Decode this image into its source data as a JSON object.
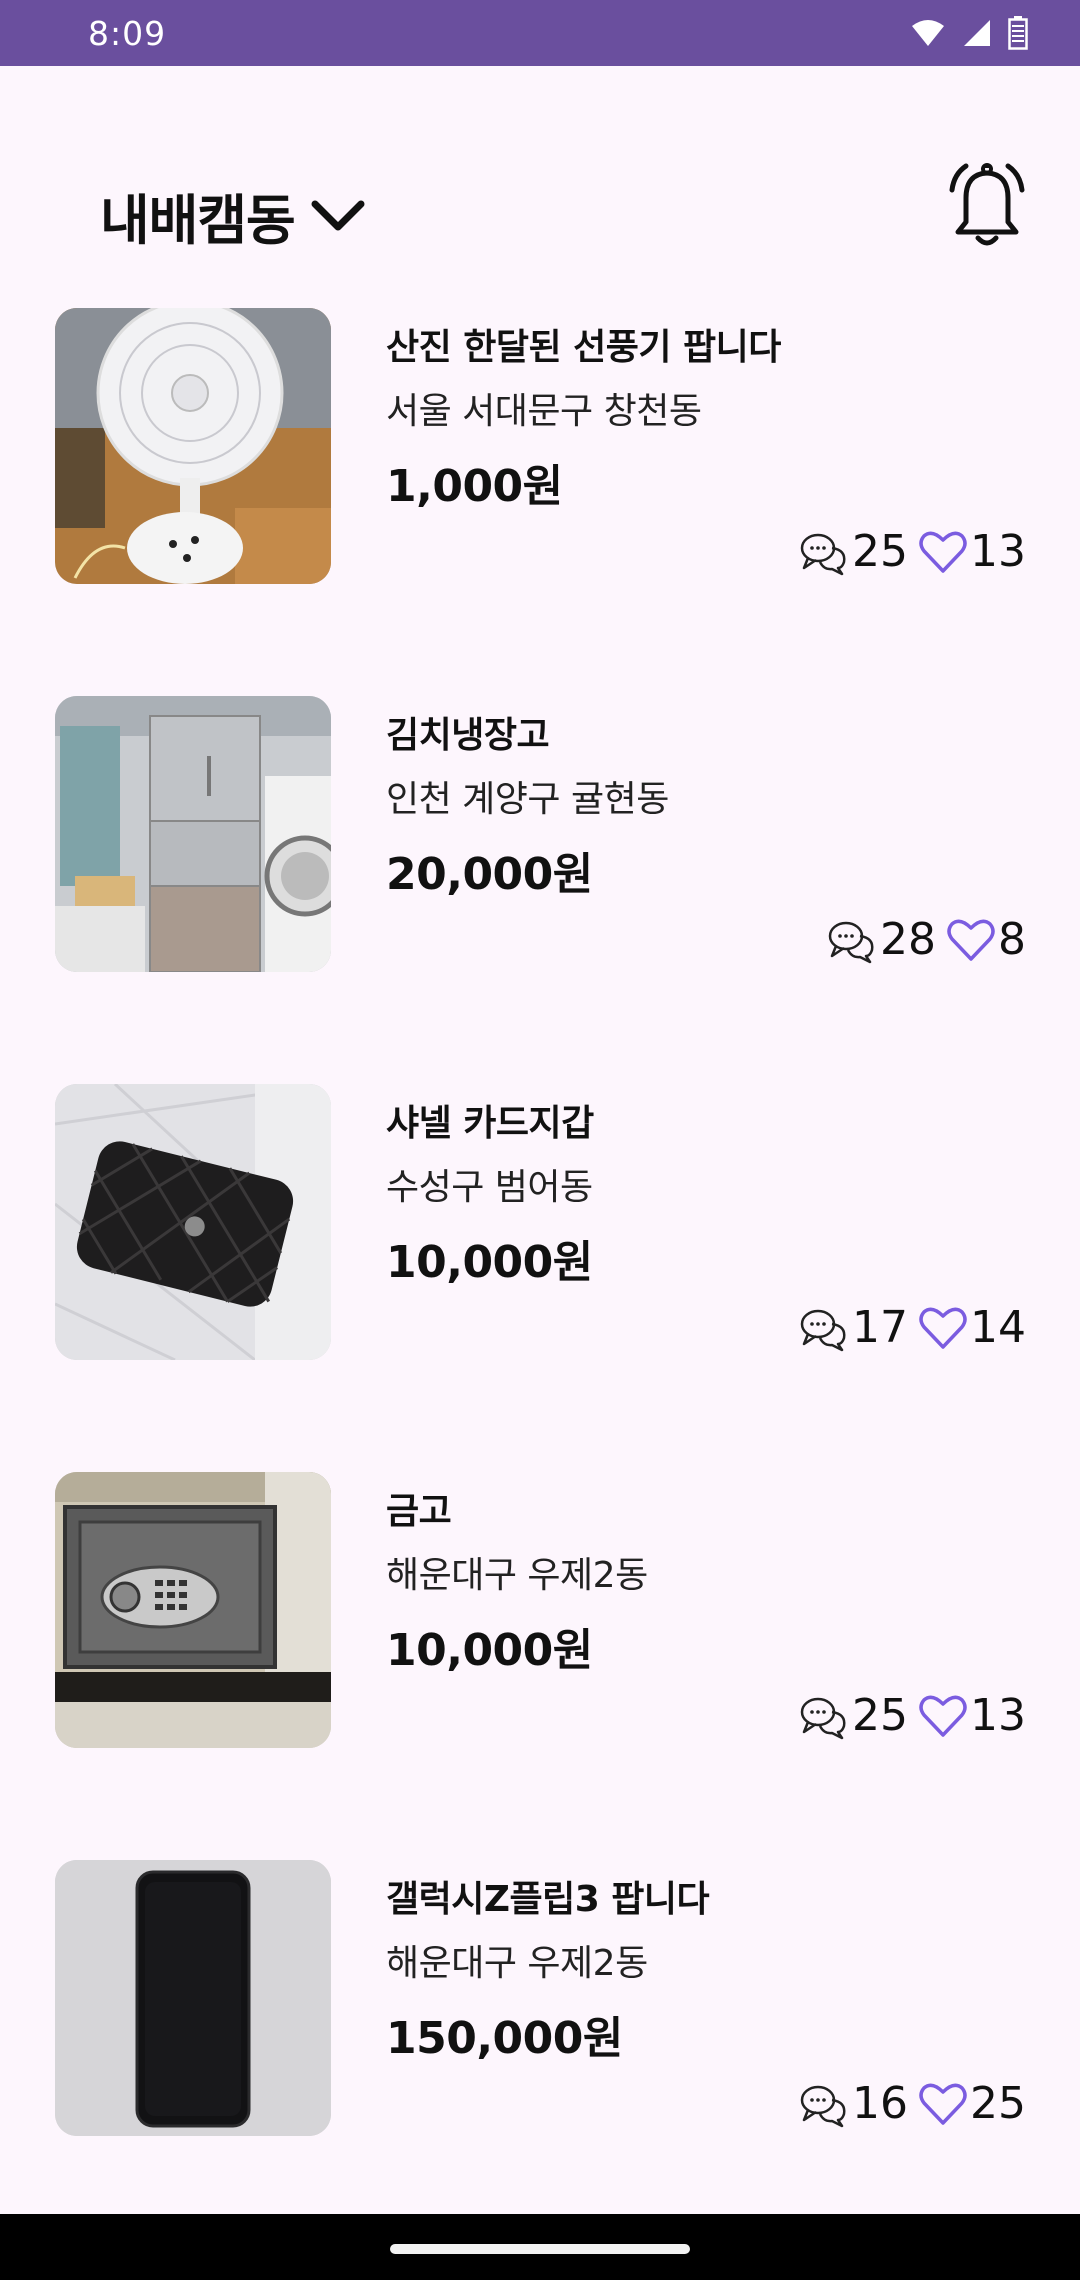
{
  "status_bar": {
    "time": "8:09"
  },
  "header": {
    "location": "내배캠동"
  },
  "items": [
    {
      "title": "산진 한달된 선풍기 팝니다",
      "location": "서울 서대문구 창천동",
      "price": "1,000원",
      "comments": "25",
      "likes": "13"
    },
    {
      "title": "김치냉장고",
      "location": "인천 계양구 귤현동",
      "price": "20,000원",
      "comments": "28",
      "likes": "8"
    },
    {
      "title": "샤넬 카드지갑",
      "location": "수성구 범어동",
      "price": "10,000원",
      "comments": "17",
      "likes": "14"
    },
    {
      "title": "금고",
      "location": "해운대구 우제2동",
      "price": "10,000원",
      "comments": "25",
      "likes": "13"
    },
    {
      "title": "갤럭시Z플립3 팝니다",
      "location": "해운대구 우제2동",
      "price": "150,000원",
      "comments": "16",
      "likes": "25"
    }
  ],
  "colors": {
    "status_bar": "#6a4f9e",
    "background": "#fdf6fd",
    "heart": "#7b5ce0"
  }
}
